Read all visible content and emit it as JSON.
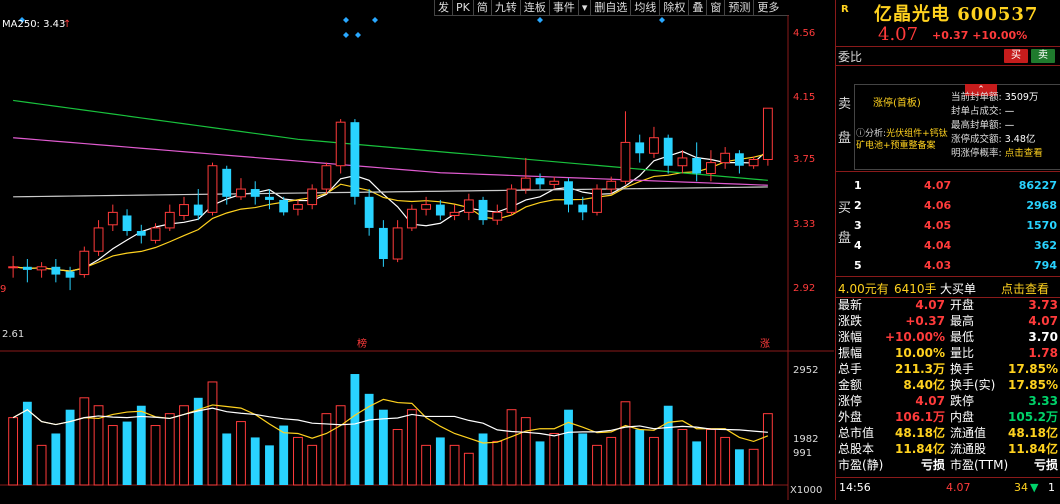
{
  "toolbar": {
    "buttons": [
      "发",
      "PK",
      "简",
      "九转",
      "连板",
      "事件"
    ],
    "buttons2": [
      "删自选",
      "均线",
      "除权",
      "叠",
      "窗",
      "预测",
      "更多"
    ]
  },
  "chart": {
    "ma_label": "MA250: 3.43",
    "y_ticks": [
      "4.56",
      "4.15",
      "3.75",
      "3.33",
      "2.92"
    ],
    "low_label": "2.61",
    "left_marker": "9",
    "tag_bang": "榜",
    "tag_zhang": "涨",
    "vol_ticks": [
      "2952",
      "1982",
      "991"
    ],
    "vol_unit": "X1000"
  },
  "chart_data": [
    {
      "type": "candlestick",
      "title": "",
      "y_ticks": [
        4.56,
        4.15,
        3.75,
        3.33,
        2.92
      ],
      "ylim": [
        2.61,
        4.56
      ],
      "grid": false,
      "ma250": 3.43,
      "candles": [
        [
          3.05,
          3.05,
          3.12,
          2.98
        ],
        [
          3.05,
          3.03,
          3.1,
          2.95
        ],
        [
          3.03,
          3.05,
          3.08,
          2.98
        ],
        [
          3.05,
          3.0,
          3.1,
          2.95
        ],
        [
          3.02,
          2.98,
          3.05,
          2.9
        ],
        [
          3.0,
          3.15,
          3.18,
          2.98
        ],
        [
          3.15,
          3.3,
          3.35,
          3.12
        ],
        [
          3.32,
          3.4,
          3.45,
          3.28
        ],
        [
          3.38,
          3.28,
          3.42,
          3.25
        ],
        [
          3.28,
          3.25,
          3.32,
          3.2
        ],
        [
          3.22,
          3.3,
          3.33,
          3.2
        ],
        [
          3.3,
          3.4,
          3.45,
          3.28
        ],
        [
          3.38,
          3.45,
          3.5,
          3.35
        ],
        [
          3.45,
          3.38,
          3.55,
          3.35
        ],
        [
          3.4,
          3.7,
          3.72,
          3.38
        ],
        [
          3.68,
          3.5,
          3.7,
          3.45
        ],
        [
          3.5,
          3.55,
          3.62,
          3.48
        ],
        [
          3.55,
          3.5,
          3.6,
          3.45
        ],
        [
          3.5,
          3.48,
          3.55,
          3.42
        ],
        [
          3.48,
          3.4,
          3.5,
          3.38
        ],
        [
          3.42,
          3.45,
          3.48,
          3.38
        ],
        [
          3.45,
          3.55,
          3.58,
          3.42
        ],
        [
          3.55,
          3.7,
          3.72,
          3.52
        ],
        [
          3.7,
          3.98,
          4.0,
          3.65
        ],
        [
          3.98,
          3.5,
          4.0,
          3.45
        ],
        [
          3.5,
          3.3,
          3.55,
          3.25
        ],
        [
          3.3,
          3.1,
          3.35,
          3.05
        ],
        [
          3.1,
          3.3,
          3.35,
          3.08
        ],
        [
          3.3,
          3.42,
          3.45,
          3.28
        ],
        [
          3.42,
          3.45,
          3.5,
          3.38
        ],
        [
          3.45,
          3.38,
          3.48,
          3.35
        ],
        [
          3.38,
          3.4,
          3.45,
          3.35
        ],
        [
          3.4,
          3.48,
          3.52,
          3.35
        ],
        [
          3.48,
          3.35,
          3.5,
          3.32
        ],
        [
          3.35,
          3.4,
          3.45,
          3.32
        ],
        [
          3.4,
          3.55,
          3.58,
          3.38
        ],
        [
          3.55,
          3.62,
          3.75,
          3.52
        ],
        [
          3.62,
          3.58,
          3.65,
          3.55
        ],
        [
          3.58,
          3.6,
          3.63,
          3.55
        ],
        [
          3.6,
          3.45,
          3.62,
          3.4
        ],
        [
          3.45,
          3.4,
          3.5,
          3.35
        ],
        [
          3.4,
          3.55,
          3.58,
          3.38
        ],
        [
          3.55,
          3.6,
          3.63,
          3.52
        ],
        [
          3.6,
          3.85,
          4.05,
          3.58
        ],
        [
          3.85,
          3.78,
          3.9,
          3.72
        ],
        [
          3.78,
          3.88,
          3.95,
          3.75
        ],
        [
          3.88,
          3.7,
          3.9,
          3.65
        ],
        [
          3.7,
          3.75,
          3.8,
          3.65
        ],
        [
          3.75,
          3.65,
          3.85,
          3.6
        ],
        [
          3.65,
          3.72,
          3.8,
          3.6
        ],
        [
          3.72,
          3.78,
          3.82,
          3.68
        ],
        [
          3.78,
          3.7,
          3.8,
          3.65
        ],
        [
          3.7,
          3.74,
          3.76,
          3.68
        ],
        [
          3.74,
          4.07,
          4.07,
          3.7
        ]
      ]
    },
    {
      "type": "bar",
      "title": "volume",
      "y_ticks": [
        2952,
        1982,
        991
      ],
      "unit": "X1000",
      "values": [
        1700,
        2100,
        1000,
        1300,
        1900,
        2200,
        2000,
        1500,
        1600,
        2000,
        1500,
        1800,
        2000,
        2200,
        2600,
        1300,
        1600,
        1200,
        1000,
        1500,
        1200,
        1000,
        1800,
        2000,
        2800,
        2300,
        1900,
        1400,
        1900,
        1000,
        1200,
        1000,
        800,
        1300,
        1100,
        1900,
        1700,
        1100,
        1300,
        1900,
        1300,
        1000,
        1200,
        2100,
        1400,
        1200,
        2000,
        1400,
        1100,
        1400,
        1200,
        900,
        900,
        1800
      ]
    }
  ],
  "quote": {
    "tag": "R",
    "name": "亿晶光电",
    "code": "600537",
    "price": "4.07",
    "change": "+0.37",
    "pct": "+10.00%",
    "ratio_label": "委比",
    "sell_btn": "买",
    "buy_btn": "卖",
    "sell_side": "卖盘",
    "limit_title": "涨停(首板)",
    "analysis_key": "分析:",
    "analysis_text": "光伏组件+钙钛矿电池+预重整备案",
    "facts": [
      {
        "k": "当前封单额:",
        "v": "3509万"
      },
      {
        "k": "封单占成交:",
        "v": "—"
      },
      {
        "k": "最高封单额:",
        "v": "—"
      },
      {
        "k": "涨停成交额:",
        "v": "3.48亿"
      },
      {
        "k": "明涨停概率:",
        "v": "点击查看"
      }
    ],
    "buy_side": "买盘",
    "bids": [
      {
        "n": "1",
        "p": "4.07",
        "v": "86227"
      },
      {
        "n": "2",
        "p": "4.06",
        "v": "2968"
      },
      {
        "n": "3",
        "p": "4.05",
        "v": "1570"
      },
      {
        "n": "4",
        "p": "4.04",
        "v": "362"
      },
      {
        "n": "5",
        "p": "4.03",
        "v": "794"
      }
    ],
    "hot_price": "4.00元有",
    "hot_qty": "6410手",
    "hot_label": "大买单",
    "hot_link": "点击查看",
    "stats": [
      {
        "k1": "最新",
        "v1": "4.07",
        "c1": "red",
        "k2": "开盘",
        "v2": "3.73",
        "c2": "red"
      },
      {
        "k1": "涨跌",
        "v1": "+0.37",
        "c1": "red",
        "k2": "最高",
        "v2": "4.07",
        "c2": "red"
      },
      {
        "k1": "涨幅",
        "v1": "+10.00%",
        "c1": "red",
        "k2": "最低",
        "v2": "3.70",
        "c2": "white"
      },
      {
        "k1": "振幅",
        "v1": "10.00%",
        "c1": "yellow",
        "k2": "量比",
        "v2": "1.78",
        "c2": "red"
      },
      {
        "k1": "总手",
        "v1": "211.3万",
        "c1": "yellow",
        "k2": "换手",
        "v2": "17.85%",
        "c2": "yellow"
      },
      {
        "k1": "金额",
        "v1": "8.40亿",
        "c1": "yellow",
        "k2": "换手(实)",
        "v2": "17.85%",
        "c2": "yellow"
      },
      {
        "k1": "涨停",
        "v1": "4.07",
        "c1": "red",
        "k2": "跌停",
        "v2": "3.33",
        "c2": "green"
      },
      {
        "k1": "外盘",
        "v1": "106.1万",
        "c1": "red",
        "k2": "内盘",
        "v2": "105.2万",
        "c2": "green"
      },
      {
        "k1": "总市值",
        "v1": "48.18亿",
        "c1": "yellow",
        "k2": "流通值",
        "v2": "48.18亿",
        "c2": "yellow"
      },
      {
        "k1": "总股本",
        "v1": "11.84亿",
        "c1": "yellow",
        "k2": "流通股",
        "v2": "11.84亿",
        "c2": "yellow"
      },
      {
        "k1": "市盈(静)",
        "v1": "亏损",
        "c1": "white",
        "k2": "市盈(TTM)",
        "v2": "亏损",
        "c2": "white"
      }
    ],
    "foot_time": "14:56",
    "foot_price": "4.07",
    "foot_vol": "34",
    "foot_n": "1"
  }
}
